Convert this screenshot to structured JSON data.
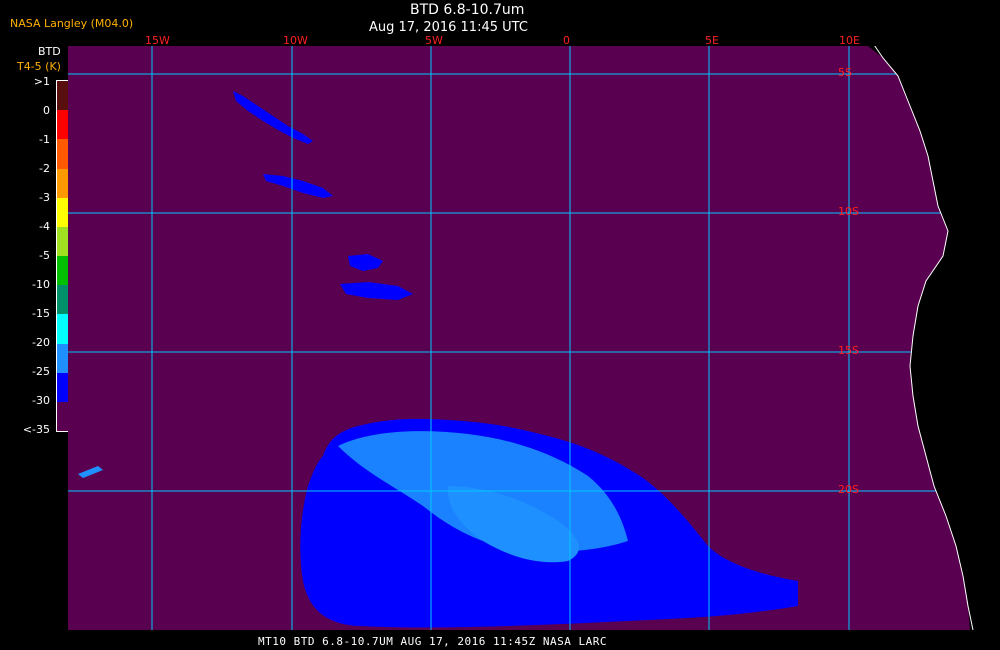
{
  "header": {
    "producer": "NASA Langley (M04.0)",
    "title": "BTD 6.8-10.7um",
    "datetime": "Aug 17, 2016 11:45 UTC"
  },
  "legend": {
    "title": "BTD",
    "units": "T4-5 (K)",
    "labels": [
      ">1",
      "0",
      "-1",
      "-2",
      "-3",
      "-4",
      "-5",
      "-10",
      "-15",
      "-20",
      "-25",
      "-30",
      "<-35"
    ],
    "colors": [
      "#5a0f0f",
      "#ff0000",
      "#ff5a00",
      "#ff9900",
      "#ffff00",
      "#a0e020",
      "#00c000",
      "#00906a",
      "#00ffff",
      "#1e90ff",
      "#0000ff",
      "#5a0050"
    ]
  },
  "map": {
    "background_color": "#5a0050",
    "grid_color": "#00c8ff",
    "label_color": "#ff2020",
    "lon_labels": [
      "15W",
      "10W",
      "5W",
      "0",
      "5E",
      "10E"
    ],
    "lat_labels": [
      "5S",
      "10S",
      "15S",
      "20S"
    ]
  },
  "footer": {
    "text": "MT10  BTD 6.8-10.7UM   AUG 17, 2016 11:45Z   NASA LARC"
  }
}
